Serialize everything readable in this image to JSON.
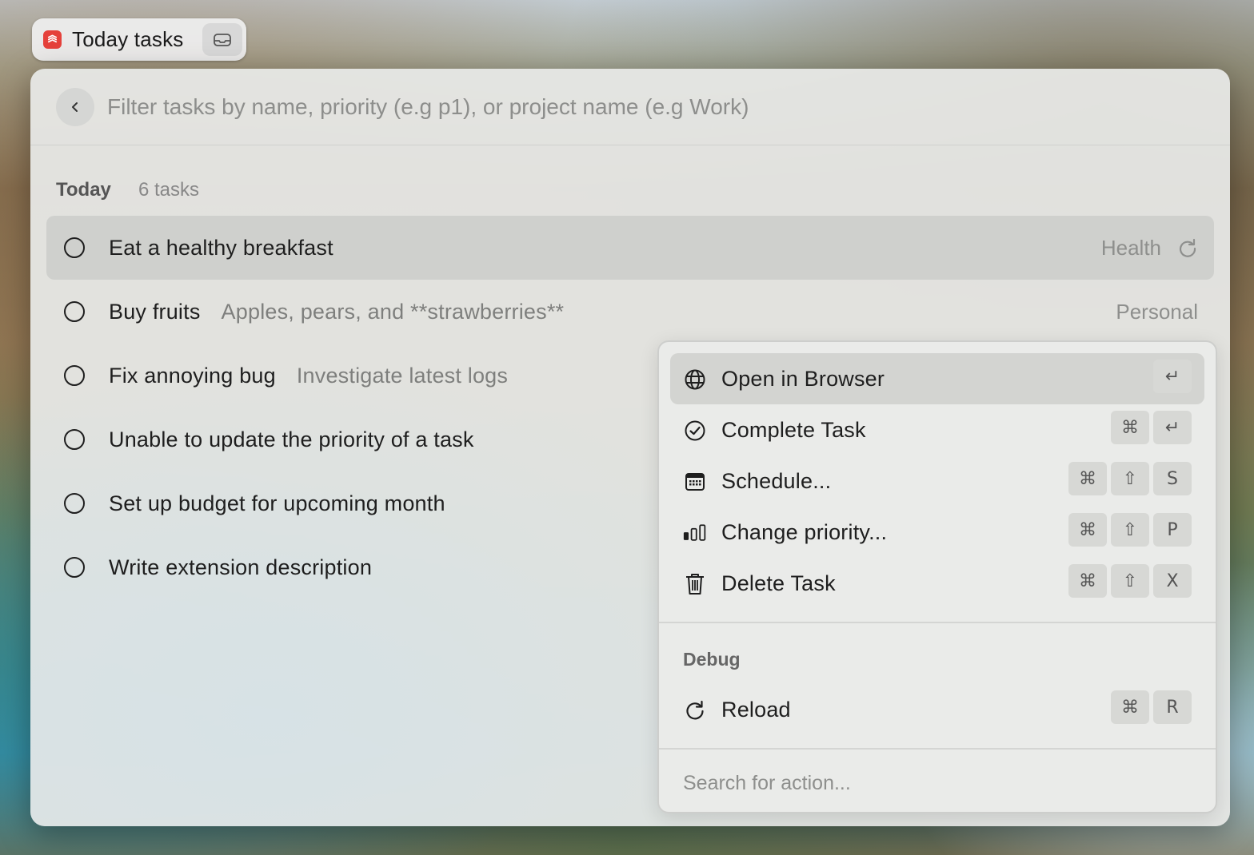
{
  "header": {
    "title": "Today tasks",
    "app_icon": "todoist-icon",
    "tray_icon": "inbox-tray-icon"
  },
  "search": {
    "placeholder": "Filter tasks by name, priority (e.g p1), or project name (e.g Work)",
    "value": ""
  },
  "section": {
    "title": "Today",
    "count": "6 tasks"
  },
  "tasks": [
    {
      "title": "Eat a healthy breakfast",
      "subtitle": "",
      "project": "Health",
      "recurring": true,
      "selected": true
    },
    {
      "title": "Buy fruits",
      "subtitle": "Apples, pears, and **strawberries**",
      "project": "Personal",
      "recurring": false
    },
    {
      "title": "Fix annoying bug",
      "subtitle": "Investigate latest logs",
      "project": "",
      "recurring": false
    },
    {
      "title": "Unable to update the priority of a task",
      "subtitle": "",
      "project": "",
      "recurring": false
    },
    {
      "title": "Set up budget for upcoming month",
      "subtitle": "",
      "project": "",
      "recurring": false
    },
    {
      "title": "Write extension description",
      "subtitle": "",
      "project": "",
      "recurring": false
    }
  ],
  "actions": [
    {
      "label": "Open in Browser",
      "icon": "globe-icon",
      "keys": [
        "↵"
      ],
      "selected": true
    },
    {
      "label": "Complete Task",
      "icon": "check-circle-icon",
      "keys": [
        "⌘",
        "↵"
      ]
    },
    {
      "label": "Schedule...",
      "icon": "calendar-icon",
      "keys": [
        "⌘",
        "⇧",
        "S"
      ]
    },
    {
      "label": "Change priority...",
      "icon": "priority-bars-icon",
      "keys": [
        "⌘",
        "⇧",
        "P"
      ]
    },
    {
      "label": "Delete Task",
      "icon": "trash-icon",
      "keys": [
        "⌘",
        "⇧",
        "X"
      ]
    }
  ],
  "debug": {
    "title": "Debug",
    "actions": [
      {
        "label": "Reload",
        "icon": "reload-icon",
        "keys": [
          "⌘",
          "R"
        ]
      }
    ]
  },
  "action_search": {
    "placeholder": "Search for action...",
    "value": ""
  },
  "colors": {
    "app_icon_red": "#e5413b",
    "selected_row": "#cfd0cd",
    "key_bg": "#d7d8d5"
  }
}
